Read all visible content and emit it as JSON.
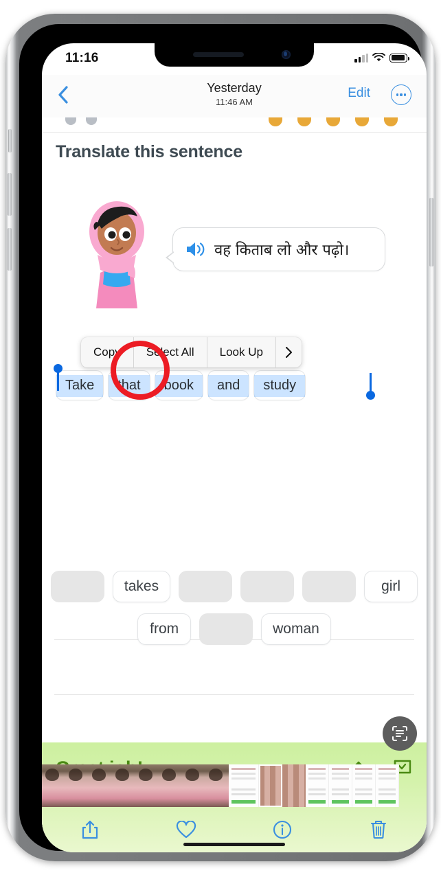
{
  "status_bar": {
    "time": "11:16",
    "signal_icon": "cellular-signal-icon",
    "wifi_icon": "wifi-icon",
    "battery_icon": "battery-icon"
  },
  "nav_bar": {
    "back_icon": "chevron-left-icon",
    "title": "Yesterday",
    "subtitle": "11:46 AM",
    "edit_label": "Edit",
    "more_icon": "ellipsis-circle-icon"
  },
  "exercise": {
    "prompt_title": "Translate this sentence",
    "character_alt": "cartoon-character-illustration",
    "speaker_icon": "speaker-wave-icon",
    "source_sentence": "वह किताब लो और पढ़ो।",
    "answer_tiles": [
      "Take",
      "that",
      "book",
      "and",
      "study"
    ],
    "word_bank_row_1": [
      {
        "label": "",
        "state": "empty"
      },
      {
        "label": "takes",
        "state": "filled"
      },
      {
        "label": "",
        "state": "empty"
      },
      {
        "label": "",
        "state": "empty"
      },
      {
        "label": "",
        "state": "empty"
      },
      {
        "label": "girl",
        "state": "filled"
      }
    ],
    "word_bank_row_2": [
      {
        "label": "from",
        "state": "filled"
      },
      {
        "label": "",
        "state": "empty"
      },
      {
        "label": "woman",
        "state": "filled"
      }
    ]
  },
  "context_menu": {
    "items": [
      {
        "label": "Copy",
        "name": "copy"
      },
      {
        "label": "Select All",
        "name": "select-all"
      },
      {
        "label": "Look Up",
        "name": "look-up"
      }
    ],
    "more_icon": "chevron-right-icon"
  },
  "success_banner": {
    "text": "Great job!",
    "share_icon": "share-up-icon",
    "flag_icon": "flag-icon",
    "scan_icon": "live-text-scan-icon"
  },
  "bottom_toolbar": {
    "share_icon": "share-icon",
    "favorite_icon": "heart-icon",
    "info_icon": "info-circle-icon",
    "delete_icon": "trash-icon"
  },
  "colors": {
    "accent_blue": "#3a8fe0",
    "selection_blue": "#0a68e0",
    "annotation_red": "#ec1c24",
    "banner_green": "#cdf0a0",
    "banner_text_green": "#4a8a13",
    "title_gray": "#3e4a52"
  },
  "annotation": {
    "highlight_target": "Copy",
    "shape": "red-circle"
  }
}
